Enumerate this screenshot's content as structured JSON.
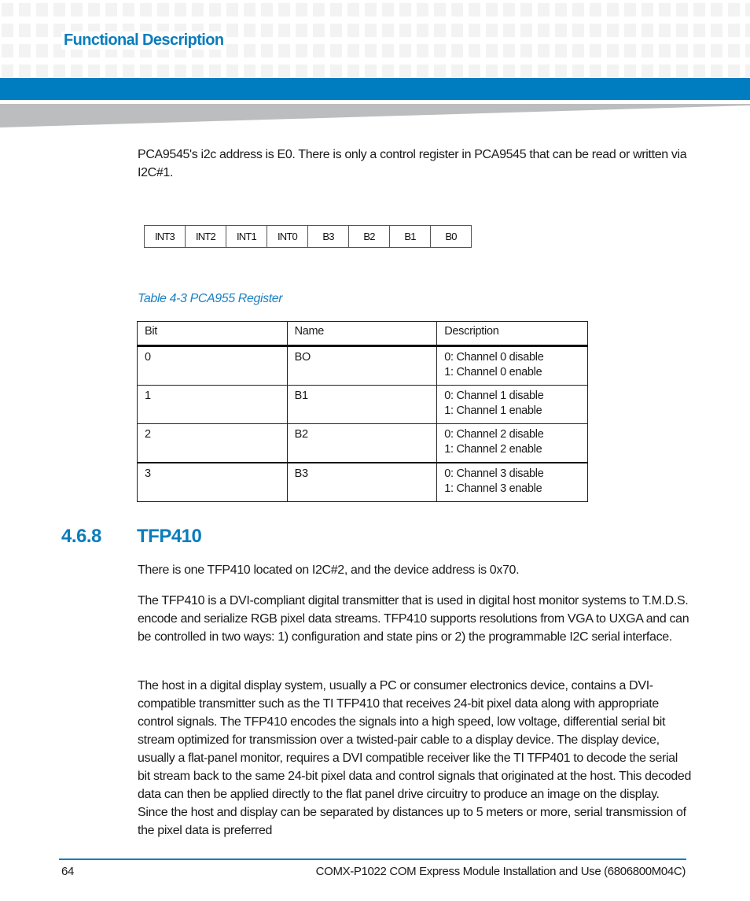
{
  "header": {
    "section_title": "Functional Description",
    "accent_color": "#007dc0"
  },
  "intro_paragraph": "PCA9545's i2c address is E0. There is only a control register in PCA9545 that can be read or written via I2C#1.",
  "register_bits": [
    "INT3",
    "INT2",
    "INT1",
    "INT0",
    "B3",
    "B2",
    "B1",
    "B0"
  ],
  "table_caption": "Table 4-3 PCA955 Register",
  "register_table": {
    "headers": [
      "Bit",
      "Name",
      "Description"
    ],
    "rows": [
      {
        "bit": "0",
        "name": "BO",
        "desc_line1": "0: Channel 0 disable",
        "desc_line2": "1: Channel 0 enable"
      },
      {
        "bit": "1",
        "name": "B1",
        "desc_line1": "0: Channel 1 disable",
        "desc_line2": "1: Channel 1 enable"
      },
      {
        "bit": "2",
        "name": "B2",
        "desc_line1": "0: Channel 2 disable",
        "desc_line2": "1: Channel 2 enable"
      },
      {
        "bit": "3",
        "name": "B3",
        "desc_line1": "0: Channel 3 disable",
        "desc_line2": "1: Channel 3 enable"
      }
    ]
  },
  "section": {
    "number": "4.6.8",
    "title": "TFP410",
    "paragraphs": [
      "There is one TFP410 located on I2C#2, and the device address is 0x70.",
      "The TFP410 is a DVI-compliant digital transmitter that is used in digital host monitor systems to T.M.D.S. encode and serialize RGB pixel data streams. TFP410 supports resolutions from VGA to UXGA and can be controlled in two ways: 1) configuration and state pins or 2) the programmable I2C serial interface.",
      "The host in a digital display system, usually a PC or consumer electronics device, contains a DVI-compatible transmitter such as the TI TFP410 that receives 24-bit pixel data along with appropriate control signals. The TFP410 encodes the signals into a high speed, low voltage, differential serial bit stream optimized for transmission over a twisted-pair cable to a display device. The display device, usually a flat-panel monitor, requires a DVI compatible receiver like the TI TFP401 to decode the serial bit stream back to the same 24-bit pixel data and control signals that originated at the host. This decoded data can then be applied directly to the flat panel drive circuitry to produce an image on the display. Since the host and display can be separated by distances up to 5 meters or more, serial transmission of the pixel data is preferred"
    ]
  },
  "footer": {
    "page_number": "64",
    "document_title": "COMX-P1022 COM Express Module Installation and Use (6806800M04C)"
  }
}
